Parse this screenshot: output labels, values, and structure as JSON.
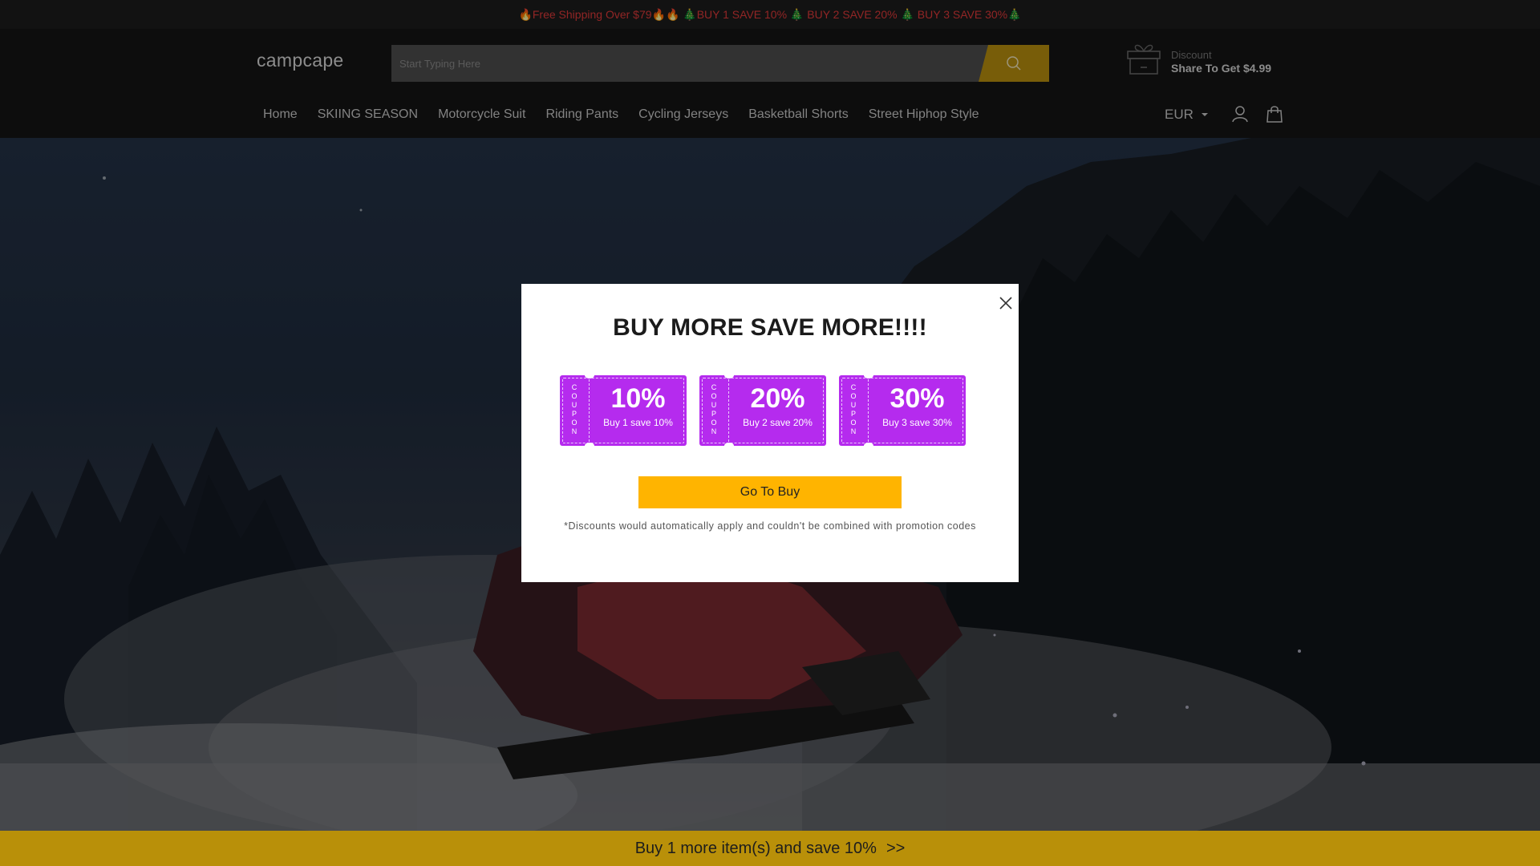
{
  "announcement": {
    "text": "🔥Free Shipping Over $79🔥🔥 🎄BUY 1 SAVE 10% 🎄 BUY 2 SAVE 20% 🎄 BUY 3 SAVE 30%🎄"
  },
  "header": {
    "logo": "campcape",
    "search_placeholder": "Start Typing Here",
    "search_icon": "search-icon",
    "discount": {
      "label": "Discount",
      "offer": "Share To Get $4.99",
      "icon": "gift-box-icon"
    },
    "nav": [
      "Home",
      "SKIING SEASON",
      "Motorcycle Suit",
      "Riding Pants",
      "Cycling Jerseys",
      "Basketball Shorts",
      "Street Hiphop Style"
    ],
    "currency": "EUR",
    "user_icon": "user-icon",
    "cart_icon": "shopping-bag-icon"
  },
  "modal": {
    "title": "BUY MORE SAVE MORE!!!!",
    "coupons": [
      {
        "stub": "COUPON",
        "percent": "10%",
        "desc": "Buy 1 save 10%"
      },
      {
        "stub": "COUPON",
        "percent": "20%",
        "desc": "Buy 2 save 20%"
      },
      {
        "stub": "COUPON",
        "percent": "30%",
        "desc": "Buy 3 save 30%"
      }
    ],
    "button": "Go To Buy",
    "note": "*Discounts would automatically apply and couldn't be combined with promotion codes",
    "close_icon": "close-icon"
  },
  "bottom_bar": {
    "text": "Buy 1 more item(s) and save 10%",
    "arrows": ">>"
  },
  "colors": {
    "accent": "#b8900f",
    "coupon": "#b52bee",
    "button": "#ffb400",
    "announcement_text": "#e03a3a"
  }
}
